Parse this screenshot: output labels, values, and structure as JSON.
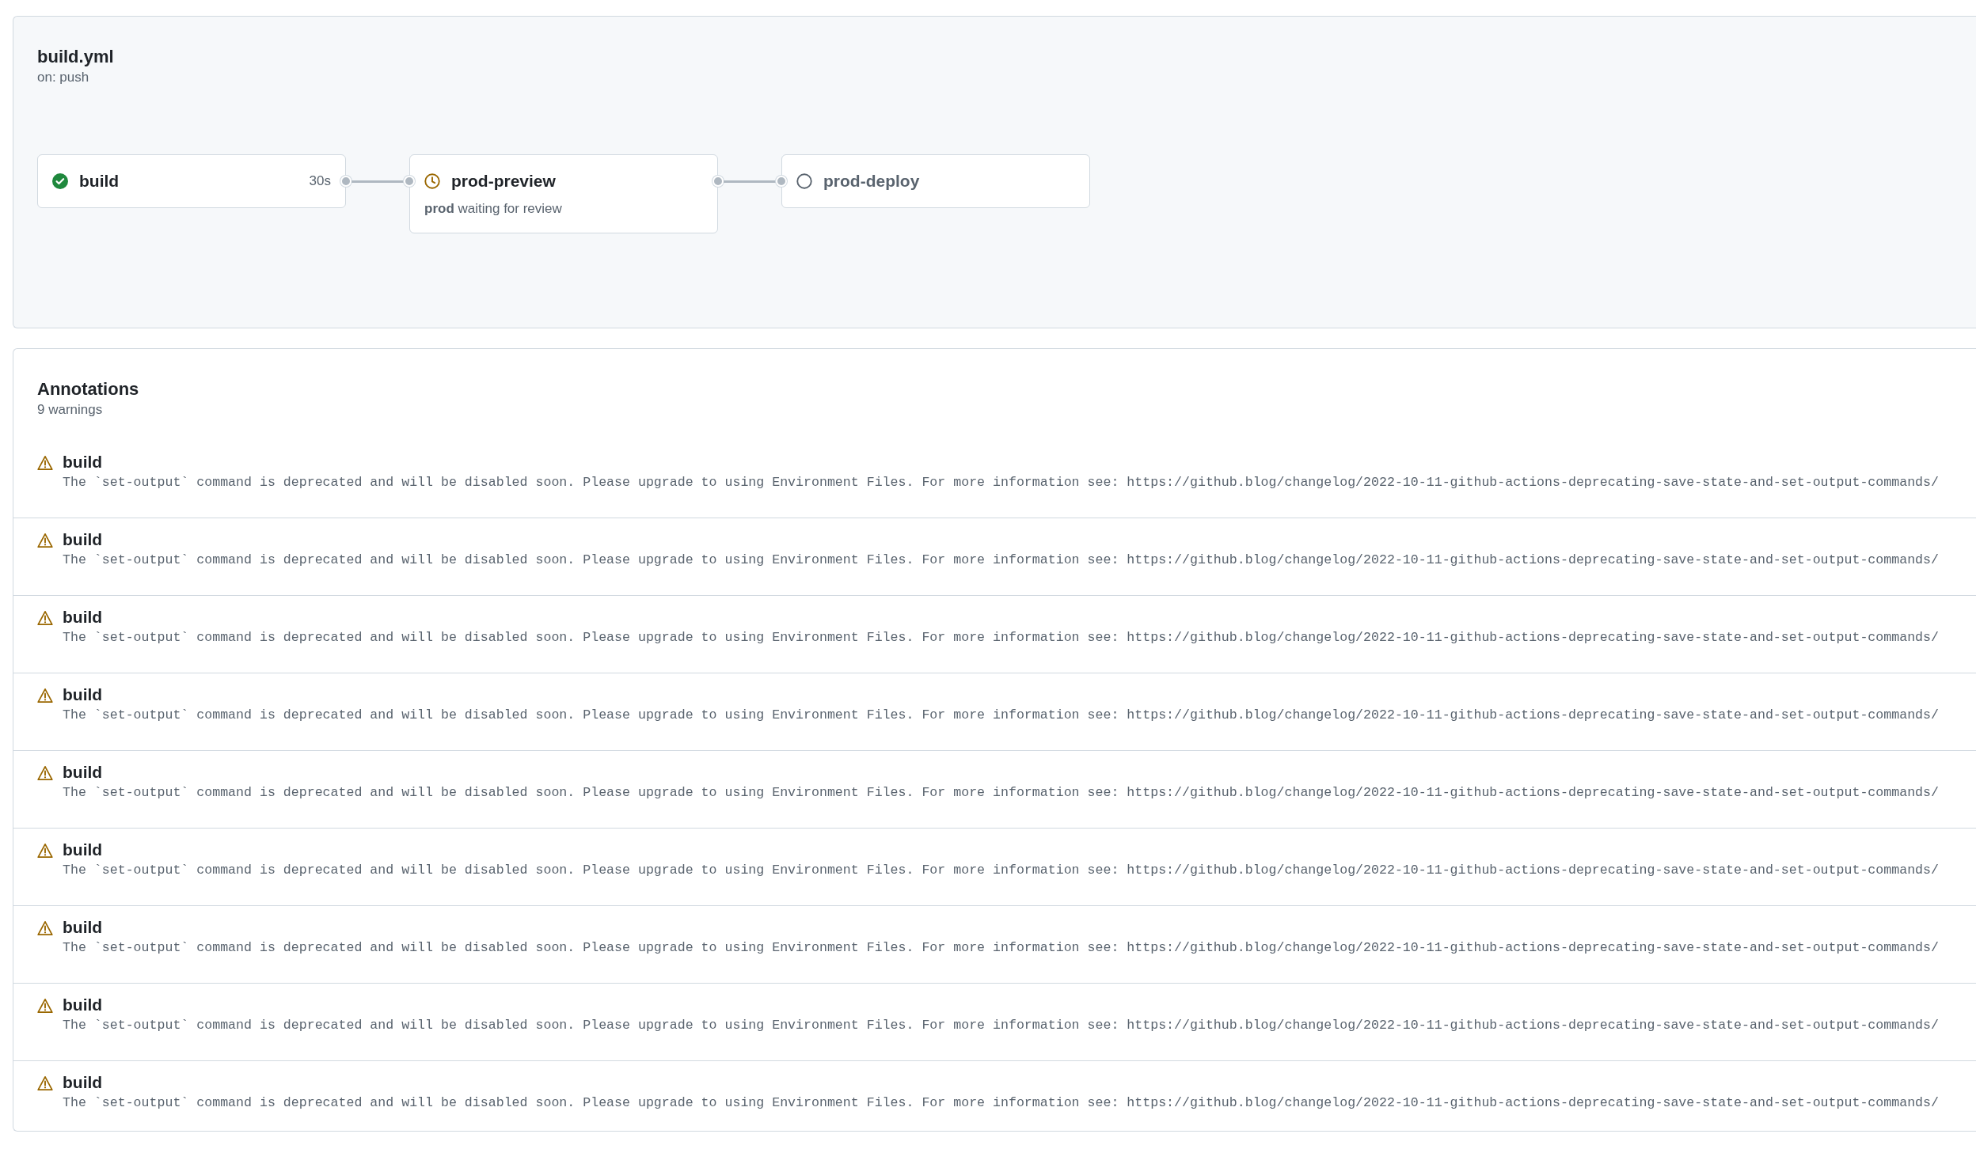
{
  "workflow": {
    "title": "build.yml",
    "trigger": "on: push"
  },
  "jobs": [
    {
      "name": "build",
      "kind": "success",
      "duration": "30s"
    },
    {
      "name": "prod-preview",
      "kind": "waiting",
      "env": "prod",
      "note": "waiting for review"
    },
    {
      "name": "prod-deploy",
      "kind": "pending"
    }
  ],
  "annotations": {
    "title": "Annotations",
    "count": "9 warnings",
    "items": [
      {
        "kind": "warning",
        "title": "build",
        "message": "The `set-output` command is deprecated and will be disabled soon. Please upgrade to using Environment Files. For more information see: https://github.blog/changelog/2022-10-11-github-actions-deprecating-save-state-and-set-output-commands/"
      },
      {
        "kind": "warning",
        "title": "build",
        "message": "The `set-output` command is deprecated and will be disabled soon. Please upgrade to using Environment Files. For more information see: https://github.blog/changelog/2022-10-11-github-actions-deprecating-save-state-and-set-output-commands/"
      },
      {
        "kind": "warning",
        "title": "build",
        "message": "The `set-output` command is deprecated and will be disabled soon. Please upgrade to using Environment Files. For more information see: https://github.blog/changelog/2022-10-11-github-actions-deprecating-save-state-and-set-output-commands/"
      },
      {
        "kind": "warning",
        "title": "build",
        "message": "The `set-output` command is deprecated and will be disabled soon. Please upgrade to using Environment Files. For more information see: https://github.blog/changelog/2022-10-11-github-actions-deprecating-save-state-and-set-output-commands/"
      },
      {
        "kind": "warning",
        "title": "build",
        "message": "The `set-output` command is deprecated and will be disabled soon. Please upgrade to using Environment Files. For more information see: https://github.blog/changelog/2022-10-11-github-actions-deprecating-save-state-and-set-output-commands/"
      },
      {
        "kind": "warning",
        "title": "build",
        "message": "The `set-output` command is deprecated and will be disabled soon. Please upgrade to using Environment Files. For more information see: https://github.blog/changelog/2022-10-11-github-actions-deprecating-save-state-and-set-output-commands/"
      },
      {
        "kind": "warning",
        "title": "build",
        "message": "The `set-output` command is deprecated and will be disabled soon. Please upgrade to using Environment Files. For more information see: https://github.blog/changelog/2022-10-11-github-actions-deprecating-save-state-and-set-output-commands/"
      },
      {
        "kind": "warning",
        "title": "build",
        "message": "The `set-output` command is deprecated and will be disabled soon. Please upgrade to using Environment Files. For more information see: https://github.blog/changelog/2022-10-11-github-actions-deprecating-save-state-and-set-output-commands/"
      },
      {
        "kind": "warning",
        "title": "build",
        "message": "The `set-output` command is deprecated and will be disabled soon. Please upgrade to using Environment Files. For more information see: https://github.blog/changelog/2022-10-11-github-actions-deprecating-save-state-and-set-output-commands/"
      }
    ]
  }
}
